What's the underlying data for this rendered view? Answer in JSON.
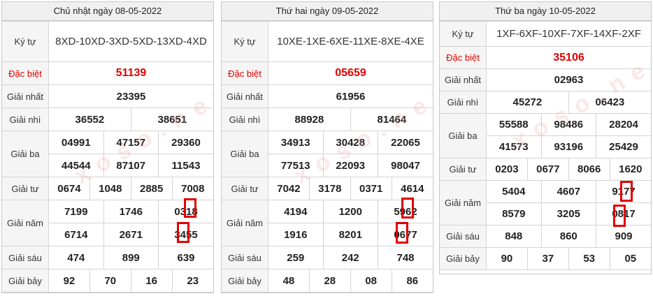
{
  "watermark": "xoso.net",
  "colors": {
    "special": "#e00000",
    "marker": "#e00000",
    "header_bg": "#f0f0f0"
  },
  "cards": [
    {
      "title": "Chủ nhật ngày 08-05-2022",
      "labels": {
        "kytu": "Ký tự",
        "db": "Đặc biệt",
        "g1": "Giải nhất",
        "g2": "Giải nhì",
        "g3": "Giải ba",
        "g4": "Giải tư",
        "g5": "Giải năm",
        "g6": "Giải sáu",
        "g7": "Giải bảy"
      },
      "kytu": "8XD-10XD-3XD-5XD-13XD-4XD",
      "db": "51139",
      "g1": "23395",
      "g2": [
        "36552",
        "38651"
      ],
      "g3": [
        "04991",
        "47157",
        "29360",
        "44544",
        "87107",
        "11543"
      ],
      "g4": [
        "0674",
        "1048",
        "2885",
        "7008"
      ],
      "g5": [
        "7199",
        "1746",
        "0318",
        "6714",
        "2671",
        "3455"
      ],
      "g6": [
        "474",
        "899",
        "639"
      ],
      "g7": [
        "92",
        "70",
        "16",
        "23"
      ]
    },
    {
      "title": "Thứ hai ngày 09-05-2022",
      "labels": {
        "kytu": "Ký tự",
        "db": "Đặc biệt",
        "g1": "Giải nhất",
        "g2": "Giải nhì",
        "g3": "Giải ba",
        "g4": "Giải tư",
        "g5": "Giải năm",
        "g6": "Giải sáu",
        "g7": "Giải bảy"
      },
      "kytu": "10XE-1XE-6XE-11XE-8XE-4XE",
      "db": "05659",
      "g1": "61956",
      "g2": [
        "88928",
        "81464"
      ],
      "g3": [
        "34913",
        "30428",
        "22065",
        "77513",
        "22093",
        "98047"
      ],
      "g4": [
        "7042",
        "3178",
        "0371",
        "4614"
      ],
      "g5": [
        "4194",
        "1200",
        "5962",
        "1916",
        "8201",
        "0677"
      ],
      "g6": [
        "259",
        "242",
        "748"
      ],
      "g7": [
        "48",
        "28",
        "08",
        "86"
      ]
    },
    {
      "title": "Thứ ba ngày 10-05-2022",
      "labels": {
        "kytu": "Ký tự",
        "db": "Đặc biệt",
        "g1": "Giải nhất",
        "g2": "Giải nhì",
        "g3": "Giải ba",
        "g4": "Giải tư",
        "g5": "Giải năm",
        "g6": "Giải sáu",
        "g7": "Giải bảy"
      },
      "kytu": "1XF-6XF-10XF-7XF-14XF-2XF",
      "db": "35106",
      "g1": "02963",
      "g2": [
        "45272",
        "06423"
      ],
      "g3": [
        "55588",
        "98486",
        "28204",
        "41573",
        "93196",
        "25429"
      ],
      "g4": [
        "0203",
        "0677",
        "8066",
        "1620"
      ],
      "g5": [
        "5404",
        "4607",
        "9177",
        "8579",
        "3205",
        "0817"
      ],
      "g6": [
        "848",
        "860",
        "909"
      ],
      "g7": [
        "90",
        "37",
        "53",
        "05"
      ]
    }
  ]
}
